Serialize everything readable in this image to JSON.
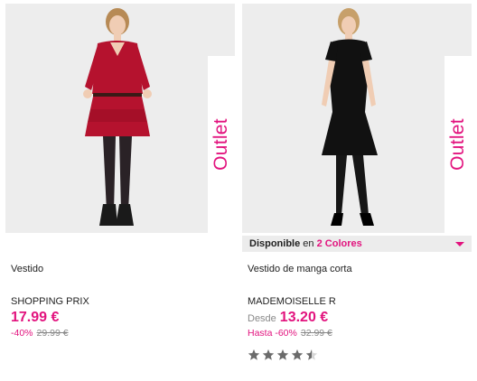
{
  "colors": {
    "accent": "#e2137e",
    "photo_bg": "#ededed",
    "star": "#6b6b6b"
  },
  "products": [
    {
      "outlet": "Outlet",
      "title": "Vestido",
      "brand": "SHOPPING PRIX",
      "price": "17.99 €",
      "discount": "-40%",
      "old_price": "29.99 €"
    },
    {
      "outlet": "Outlet",
      "availability": {
        "label": "Disponible",
        "mid": "en",
        "colors": "2 Colores"
      },
      "title": "Vestido de manga corta",
      "brand": "MADEMOISELLE R",
      "price_prefix": "Desde",
      "price": "13.20 €",
      "discount": "Hasta -60%",
      "old_price": "32.99 €",
      "rating": {
        "value": 4.5,
        "max": 5
      }
    }
  ]
}
